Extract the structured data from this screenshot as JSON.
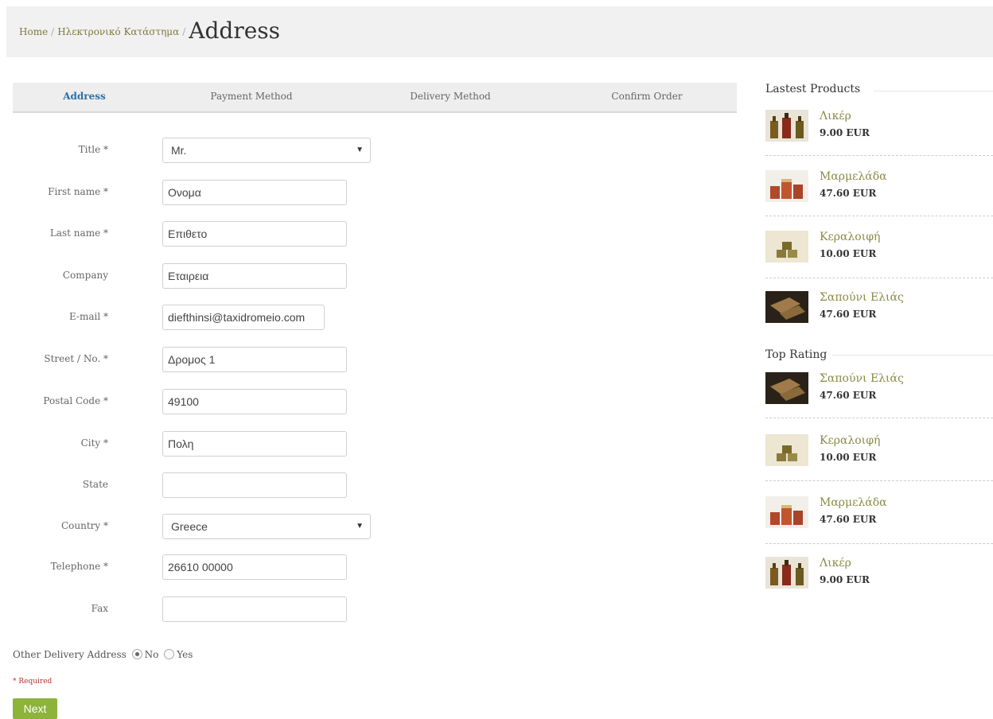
{
  "breadcrumb": {
    "home": "Home",
    "separator": "/",
    "shop": "Ηλεκτρονικό Κατάστημα",
    "current": "Address"
  },
  "steps": [
    {
      "label": "Address",
      "active": true
    },
    {
      "label": "Payment Method",
      "active": false
    },
    {
      "label": "Delivery Method",
      "active": false
    },
    {
      "label": "Confirm Order",
      "active": false
    }
  ],
  "form": {
    "title": {
      "label": "Title *",
      "value": "Mr."
    },
    "first_name": {
      "label": "First name *",
      "value": "Ονομα"
    },
    "last_name": {
      "label": "Last name *",
      "value": "Επιθετο"
    },
    "company": {
      "label": "Company",
      "value": "Εταιρεια"
    },
    "email": {
      "label": "E-mail *",
      "value": "diefthinsi@taxidromeio.com"
    },
    "street": {
      "label": "Street / No. *",
      "value": "Δρομος 1"
    },
    "postal_code": {
      "label": "Postal Code *",
      "value": "49100"
    },
    "city": {
      "label": "City *",
      "value": "Πολη"
    },
    "state": {
      "label": "State",
      "value": ""
    },
    "country": {
      "label": "Country *",
      "value": "Greece"
    },
    "telephone": {
      "label": "Telephone *",
      "value": "26610 00000"
    },
    "fax": {
      "label": "Fax",
      "value": ""
    }
  },
  "other_delivery": {
    "label": "Other Delivery Address",
    "no": "No",
    "yes": "Yes",
    "selected": "No"
  },
  "required_note": "* Required",
  "next_button": "Next",
  "colors": {
    "accent_green": "#8db33b",
    "active_step": "#2a6fa8",
    "product_link": "#8a8a45"
  },
  "latest_products": {
    "heading": "Lastest Products",
    "items": [
      {
        "name": "Λικέρ",
        "price": "9.00 EUR",
        "image": "liqueur-bottles"
      },
      {
        "name": "Μαρμελάδα",
        "price": "47.60 EUR",
        "image": "jam-jars"
      },
      {
        "name": "Κεραλοιφή",
        "price": "10.00 EUR",
        "image": "wax-ointment-jars"
      },
      {
        "name": "Σαπούνι Ελιάς",
        "price": "47.60 EUR",
        "image": "olive-soap-bars"
      }
    ]
  },
  "top_rating": {
    "heading": "Top Rating",
    "items": [
      {
        "name": "Σαπούνι Ελιάς",
        "price": "47.60 EUR",
        "image": "olive-soap-bars"
      },
      {
        "name": "Κεραλοιφή",
        "price": "10.00 EUR",
        "image": "wax-ointment-jars"
      },
      {
        "name": "Μαρμελάδα",
        "price": "47.60 EUR",
        "image": "jam-jars"
      },
      {
        "name": "Λικέρ",
        "price": "9.00 EUR",
        "image": "liqueur-bottles"
      }
    ]
  }
}
